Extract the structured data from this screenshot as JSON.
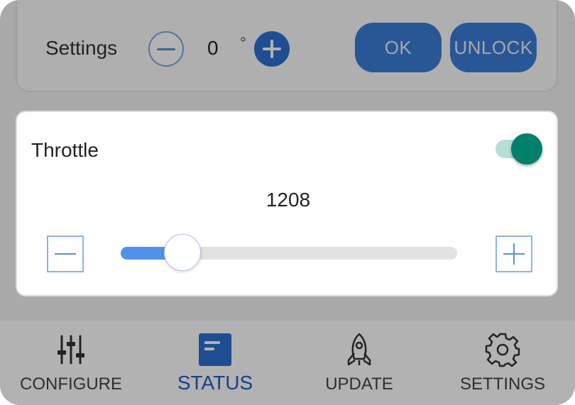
{
  "top_bar": {
    "label": "Settings",
    "value": "0",
    "unit": "°",
    "ok_label": "OK",
    "unlock_label": "UNLOCK"
  },
  "throttle": {
    "title": "Throttle",
    "enabled": true,
    "value": "1208",
    "slider_level": 0.15
  },
  "nav": {
    "items": [
      {
        "label": "CONFIGURE",
        "icon": "sliders-icon",
        "active": false
      },
      {
        "label": "STATUS",
        "icon": "status-icon",
        "active": true
      },
      {
        "label": "UPDATE",
        "icon": "rocket-icon",
        "active": false
      },
      {
        "label": "SETTINGS",
        "icon": "gear-icon",
        "active": false
      }
    ]
  },
  "colors": {
    "accent": "#2d6fd1",
    "toggle_on": "#00806a",
    "active_nav": "#1f5fbf"
  }
}
